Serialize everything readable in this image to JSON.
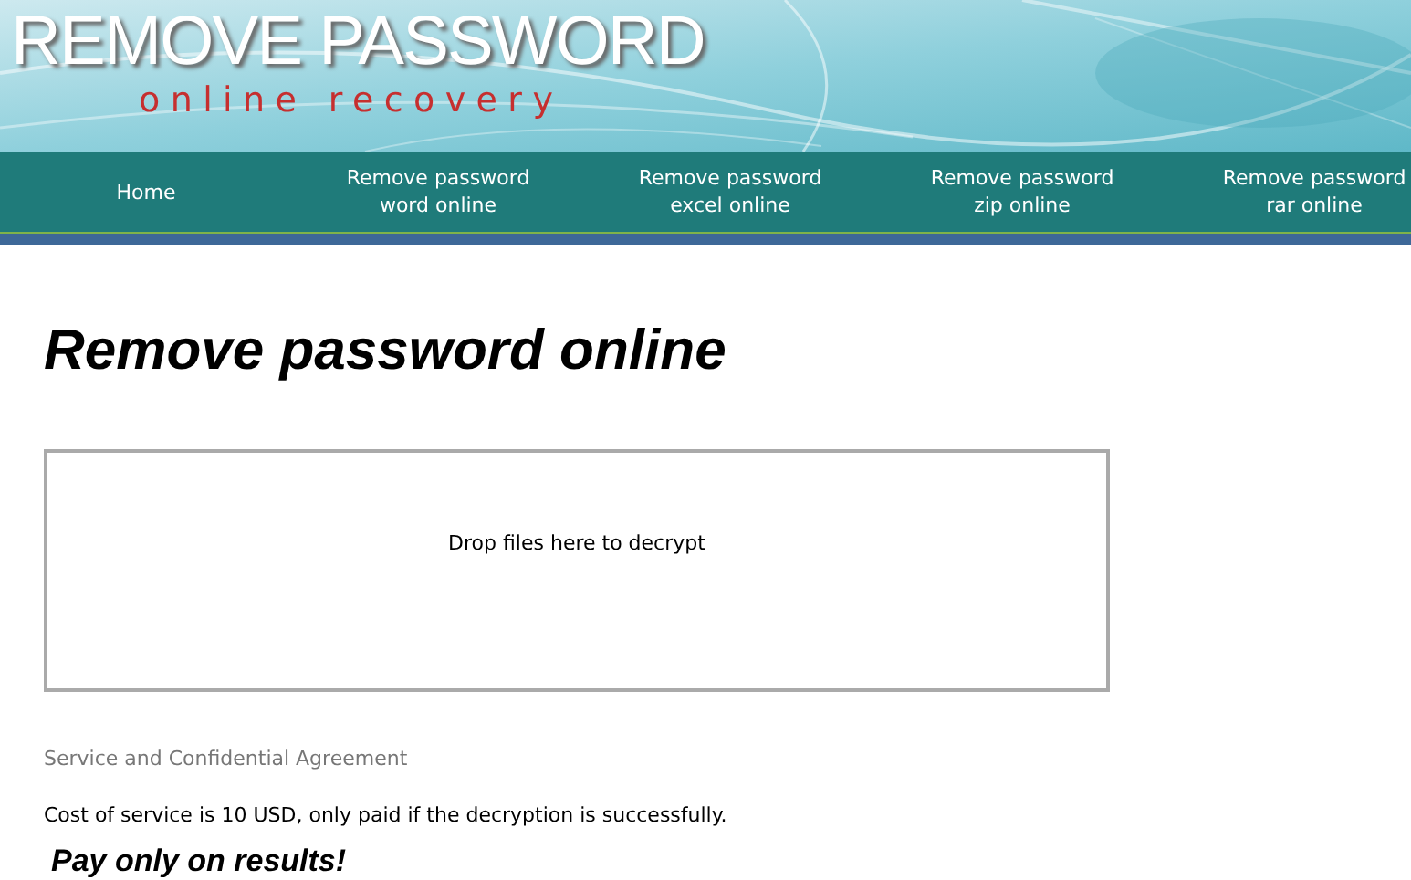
{
  "header": {
    "logo_title": "REMOVE PASSWORD",
    "logo_subtitle": "online recovery"
  },
  "nav": [
    {
      "lines": [
        "Home"
      ]
    },
    {
      "lines": [
        "Remove password",
        "word online"
      ]
    },
    {
      "lines": [
        "Remove password",
        "excel online"
      ]
    },
    {
      "lines": [
        "Remove password",
        "zip online"
      ]
    },
    {
      "lines": [
        "Remove password",
        "rar online"
      ]
    }
  ],
  "main": {
    "title": "Remove password online",
    "drop_zone": "Drop files here to decrypt",
    "agreement_link": "Service and Confidential Agreement",
    "cost_text": "Cost of service is 10 USD, only paid if the decryption is successfully.",
    "slogan": "Pay only on results!"
  }
}
